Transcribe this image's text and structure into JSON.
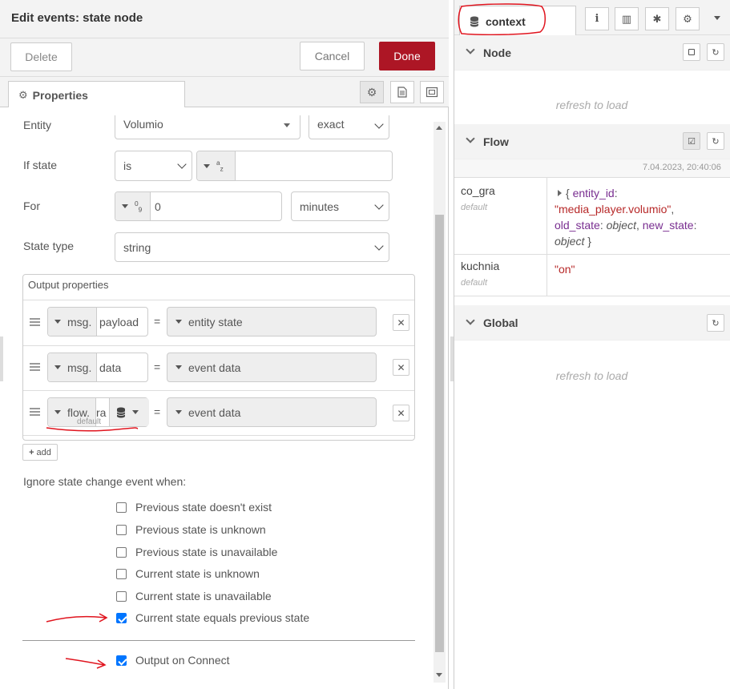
{
  "editor": {
    "title": "Edit events: state node",
    "delete_label": "Delete",
    "cancel_label": "Cancel",
    "done_label": "Done",
    "tab_properties": "Properties"
  },
  "form": {
    "entity_label": "Entity",
    "entity_value": "Volumio",
    "entity_match": "exact",
    "if_state_label": "If state",
    "if_state_op": "is",
    "if_state_type_icon": "az",
    "for_label": "For",
    "for_value": "0",
    "for_units": "minutes",
    "for_type_icon": "09",
    "state_type_label": "State type",
    "state_type_value": "string",
    "output_title": "Output properties",
    "outputs": [
      {
        "prefix": "msg.",
        "prop": "payload",
        "value": "entity state"
      },
      {
        "prefix": "msg.",
        "prop": "data",
        "value": "event data"
      },
      {
        "prefix": "flow.",
        "prop": "ra",
        "store": "default",
        "value": "event data"
      }
    ],
    "add_label": "add",
    "ignore_title": "Ignore state change event when:",
    "checks": [
      {
        "label": "Previous state doesn't exist",
        "checked": false
      },
      {
        "label": "Previous state is unknown",
        "checked": false
      },
      {
        "label": "Previous state is unavailable",
        "checked": false
      },
      {
        "label": "Current state is unknown",
        "checked": false
      },
      {
        "label": "Current state is unavailable",
        "checked": false
      },
      {
        "label": "Current state equals previous state",
        "checked": true
      }
    ],
    "output_on_connect": {
      "label": "Output on Connect",
      "checked": true
    }
  },
  "sidebar": {
    "tab_context": "context",
    "node_title": "Node",
    "node_refresh": "refresh to load",
    "flow_title": "Flow",
    "flow_timestamp": "7.04.2023, 20:40:06",
    "flow_items": [
      {
        "key": "co_gra",
        "scope": "default",
        "v_open": "{ ",
        "k1": "entity_id",
        "v1": "\"media_player.volumio\"",
        "k2": "old_state",
        "v2": "object",
        "k3": "new_state",
        "v3": "object",
        "v_close": " }"
      },
      {
        "key": "kuchnia",
        "scope": "default",
        "value": "\"on\""
      }
    ],
    "global_title": "Global",
    "global_refresh": "refresh to load"
  }
}
